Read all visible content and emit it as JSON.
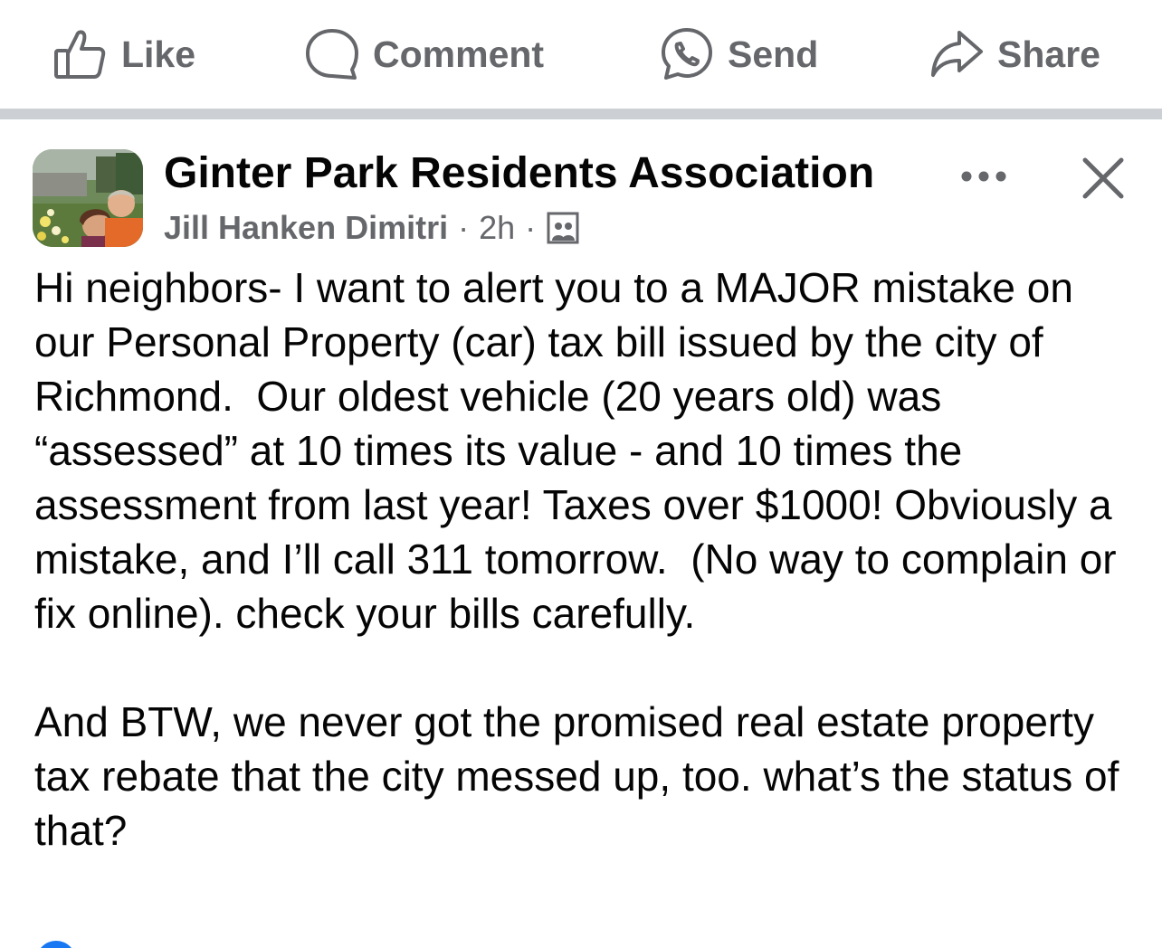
{
  "actions": {
    "like_label": "Like",
    "comment_label": "Comment",
    "send_label": "Send",
    "share_label": "Share",
    "icons": [
      "thumbs-up-icon",
      "comment-bubble-icon",
      "messenger-icon",
      "share-arrow-icon"
    ]
  },
  "post": {
    "group_name": "Ginter Park Residents Association",
    "author": "Jill Hanken Dimitri",
    "separator": "·",
    "time": "2h",
    "audience_icon": "group-members-icon",
    "paragraphs": [
      "Hi neighbors- I want to alert you to a MAJOR mistake on our Personal Property (car) tax bill issued by the city of Richmond.  Our oldest vehicle (20 years old) was “assessed” at 10 times its value - and 10 times the assessment from last year! Taxes over $1000! Obviously a mistake, and I’ll call 311 tomorrow.  (No way to complain or fix online). check your bills carefully.",
      "And BTW, we never got the promised real estate property tax rebate that the city messed up, too. what’s the status of that?"
    ]
  },
  "colors": {
    "muted_text": "#65676b",
    "separator": "#ccd0d5",
    "reaction_blue": "#1877f2"
  }
}
